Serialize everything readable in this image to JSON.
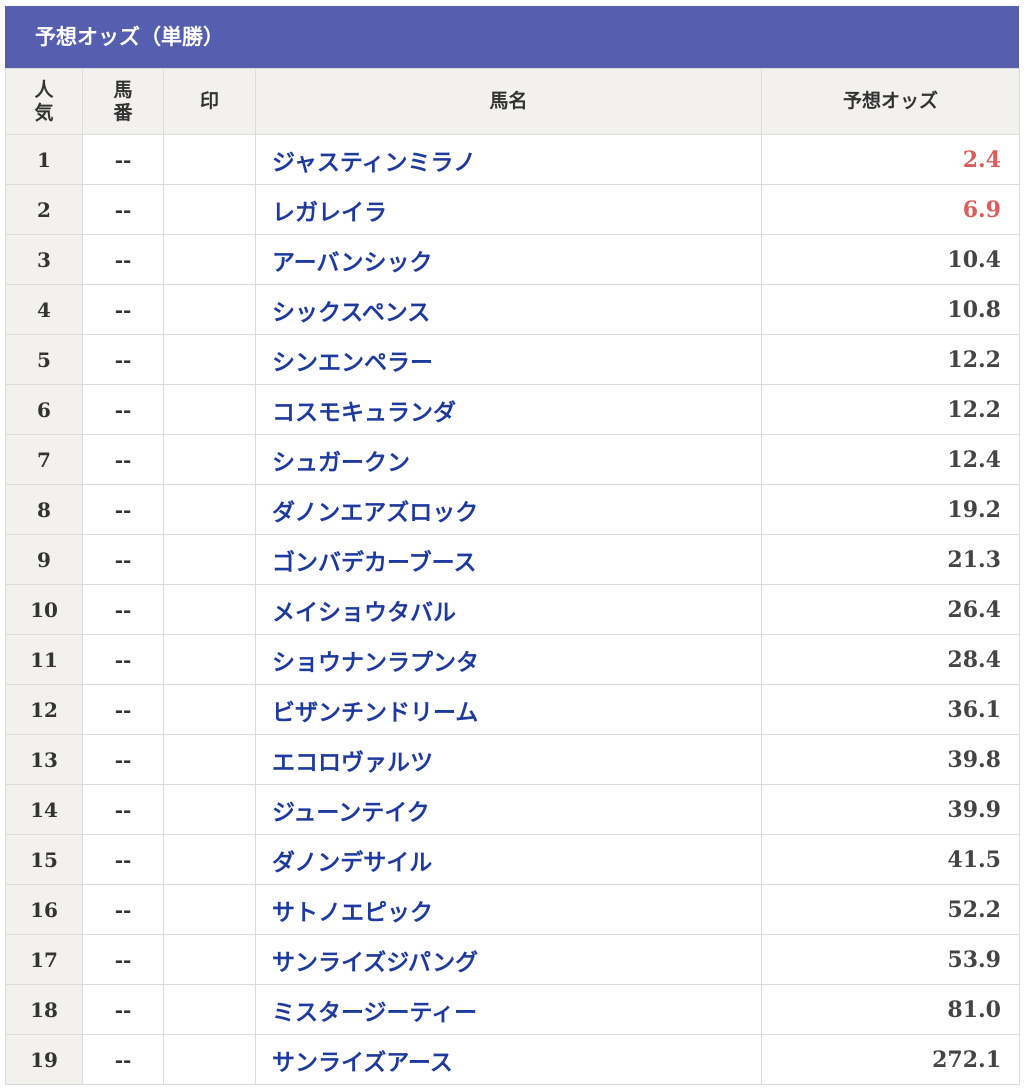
{
  "panel": {
    "title": "予想オッズ（単勝）"
  },
  "table": {
    "headers": {
      "rank_line1": "人",
      "rank_line2": "気",
      "num_line1": "馬",
      "num_line2": "番",
      "mark": "印",
      "horse": "馬名",
      "odds": "予想オッズ"
    },
    "rows": [
      {
        "rank": "1",
        "num": "--",
        "mark": "",
        "horse": "ジャスティンミラノ",
        "odds": "2.4",
        "highlight": true
      },
      {
        "rank": "2",
        "num": "--",
        "mark": "",
        "horse": "レガレイラ",
        "odds": "6.9",
        "highlight": true
      },
      {
        "rank": "3",
        "num": "--",
        "mark": "",
        "horse": "アーバンシック",
        "odds": "10.4",
        "highlight": false
      },
      {
        "rank": "4",
        "num": "--",
        "mark": "",
        "horse": "シックスペンス",
        "odds": "10.8",
        "highlight": false
      },
      {
        "rank": "5",
        "num": "--",
        "mark": "",
        "horse": "シンエンペラー",
        "odds": "12.2",
        "highlight": false
      },
      {
        "rank": "6",
        "num": "--",
        "mark": "",
        "horse": "コスモキュランダ",
        "odds": "12.2",
        "highlight": false
      },
      {
        "rank": "7",
        "num": "--",
        "mark": "",
        "horse": "シュガークン",
        "odds": "12.4",
        "highlight": false
      },
      {
        "rank": "8",
        "num": "--",
        "mark": "",
        "horse": "ダノンエアズロック",
        "odds": "19.2",
        "highlight": false
      },
      {
        "rank": "9",
        "num": "--",
        "mark": "",
        "horse": "ゴンバデカーブース",
        "odds": "21.3",
        "highlight": false
      },
      {
        "rank": "10",
        "num": "--",
        "mark": "",
        "horse": "メイショウタバル",
        "odds": "26.4",
        "highlight": false
      },
      {
        "rank": "11",
        "num": "--",
        "mark": "",
        "horse": "ショウナンラプンタ",
        "odds": "28.4",
        "highlight": false
      },
      {
        "rank": "12",
        "num": "--",
        "mark": "",
        "horse": "ビザンチンドリーム",
        "odds": "36.1",
        "highlight": false
      },
      {
        "rank": "13",
        "num": "--",
        "mark": "",
        "horse": "エコロヴァルツ",
        "odds": "39.8",
        "highlight": false
      },
      {
        "rank": "14",
        "num": "--",
        "mark": "",
        "horse": "ジューンテイク",
        "odds": "39.9",
        "highlight": false
      },
      {
        "rank": "15",
        "num": "--",
        "mark": "",
        "horse": "ダノンデサイル",
        "odds": "41.5",
        "highlight": false
      },
      {
        "rank": "16",
        "num": "--",
        "mark": "",
        "horse": "サトノエピック",
        "odds": "52.2",
        "highlight": false
      },
      {
        "rank": "17",
        "num": "--",
        "mark": "",
        "horse": "サンライズジパング",
        "odds": "53.9",
        "highlight": false
      },
      {
        "rank": "18",
        "num": "--",
        "mark": "",
        "horse": "ミスタージーティー",
        "odds": "81.0",
        "highlight": false
      },
      {
        "rank": "19",
        "num": "--",
        "mark": "",
        "horse": "サンライズアース",
        "odds": "272.1",
        "highlight": false
      }
    ]
  },
  "colors": {
    "header_bg": "#565eaf",
    "horse_link": "#1f3a9e",
    "favorite_odds": "#dd5c5c",
    "rank_cell_bg": "#f3f1ee"
  }
}
